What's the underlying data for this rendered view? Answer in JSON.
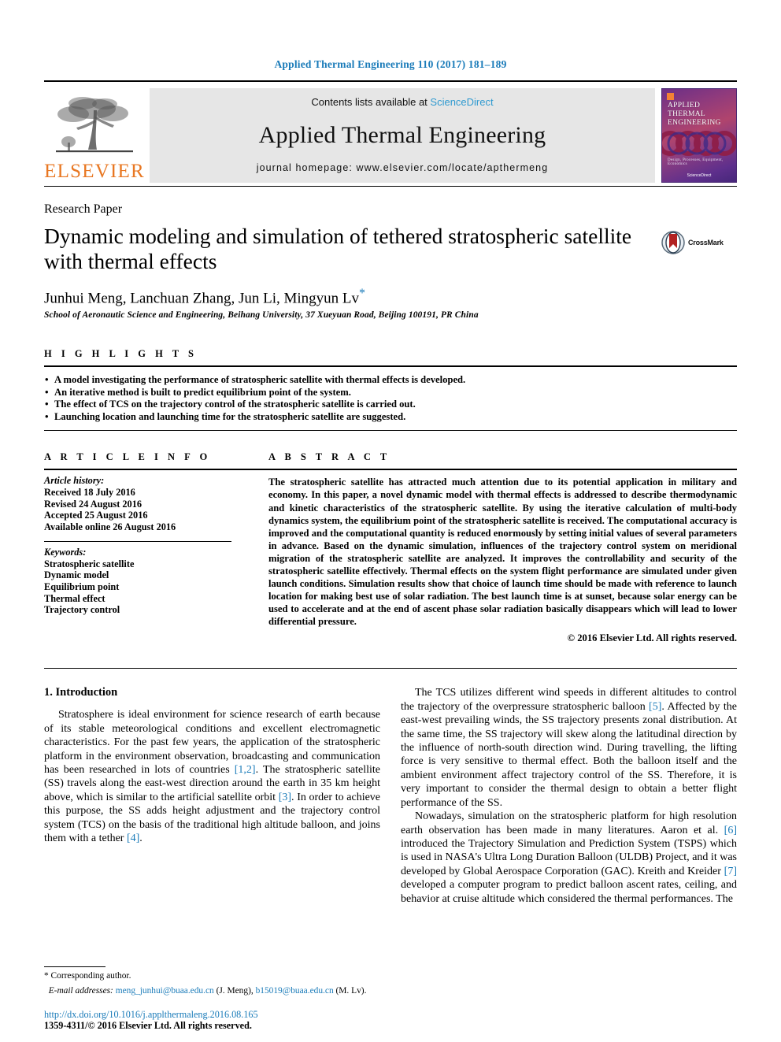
{
  "running_head": "Applied Thermal Engineering 110 (2017) 181–189",
  "masthead": {
    "publisher_name": "ELSEVIER",
    "publisher_logo_icon": "elsevier-tree-icon",
    "contents_prefix": "Contents lists available at ",
    "contents_link": "ScienceDirect",
    "journal_name": "Applied Thermal Engineering",
    "homepage": "journal homepage: www.elsevier.com/locate/apthermeng",
    "cover": {
      "title_line1": "APPLIED",
      "title_line2": "THERMAL",
      "title_line3": "ENGINEERING",
      "footer_line": "Design, Processes, Equipment, Economics",
      "footer_line2": "ScienceDirect"
    }
  },
  "article": {
    "type": "Research Paper",
    "title": "Dynamic modeling and simulation of tethered stratospheric satellite with thermal effects",
    "crossmark_label": "CrossMark",
    "crossmark_icon": "crossmark-icon",
    "authors": "Junhui Meng, Lanchuan Zhang, Jun Li, Mingyun Lv",
    "corresponding_marker": "*",
    "affiliation": "School of Aeronautic Science and Engineering, Beihang University, 37 Xueyuan Road, Beijing 100191, PR China"
  },
  "highlights": {
    "heading": "H I G H L I G H T S",
    "items": [
      "A model investigating the performance of stratospheric satellite with thermal effects is developed.",
      "An iterative method is built to predict equilibrium point of the system.",
      "The effect of TCS on the trajectory control of the stratospheric satellite is carried out.",
      "Launching location and launching time for the stratospheric satellite are suggested."
    ]
  },
  "article_info": {
    "heading": "A R T I C L E    I N F O",
    "history_label": "Article history:",
    "history": [
      "Received 18 July 2016",
      "Revised 24 August 2016",
      "Accepted 25 August 2016",
      "Available online 26 August 2016"
    ],
    "keywords_label": "Keywords:",
    "keywords": [
      "Stratospheric satellite",
      "Dynamic model",
      "Equilibrium point",
      "Thermal effect",
      "Trajectory control"
    ]
  },
  "abstract": {
    "heading": "A B S T R A C T",
    "text": "The stratospheric satellite has attracted much attention due to its potential application in military and economy. In this paper, a novel dynamic model with thermal effects is addressed to describe thermodynamic and kinetic characteristics of the stratospheric satellite. By using the iterative calculation of multi-body dynamics system, the equilibrium point of the stratospheric satellite is received. The computational accuracy is improved and the computational quantity is reduced enormously by setting initial values of several parameters in advance. Based on the dynamic simulation, influences of the trajectory control system on meridional migration of the stratospheric satellite are analyzed. It improves the controllability and security of the stratospheric satellite effectively. Thermal effects on the system flight performance are simulated under given launch conditions. Simulation results show that choice of launch time should be made with reference to launch location for making best use of solar radiation. The best launch time is at sunset, because solar energy can be used to accelerate and at the end of ascent phase solar radiation basically disappears which will lead to lower differential pressure.",
    "copyright": "© 2016 Elsevier Ltd. All rights reserved."
  },
  "body": {
    "section_heading": "1. Introduction",
    "left_paragraphs": [
      "Stratosphere is ideal environment for science research of earth because of its stable meteorological conditions and excellent electromagnetic characteristics. For the past few years, the application of the stratospheric platform in the environment observation, broadcasting and communication has been researched in lots of countries [1,2]. The stratospheric satellite (SS) travels along the east-west direction around the earth in 35 km height above, which is similar to the artificial satellite orbit [3]. In order to achieve this purpose, the SS adds height adjustment and the trajectory control system (TCS) on the basis of the traditional high altitude balloon, and joins them with a tether [4]."
    ],
    "right_paragraphs": [
      "The TCS utilizes different wind speeds in different altitudes to control the trajectory of the overpressure stratospheric balloon [5]. Affected by the east-west prevailing winds, the SS trajectory presents zonal distribution. At the same time, the SS trajectory will skew along the latitudinal direction by the influence of north-south direction wind. During travelling, the lifting force is very sensitive to thermal effect. Both the balloon itself and the ambient environment affect trajectory control of the SS. Therefore, it is very important to consider the thermal design to obtain a better flight performance of the SS.",
      "Nowadays, simulation on the stratospheric platform for high resolution earth observation has been made in many literatures. Aaron et al. [6] introduced the Trajectory Simulation and Prediction System (TSPS) which is used in NASA's Ultra Long Duration Balloon (ULDB) Project, and it was developed by Global Aerospace Corporation (GAC). Kreith and Kreider [7] developed a computer program to predict balloon ascent rates, ceiling, and behavior at cruise altitude which considered the thermal performances. The"
    ]
  },
  "footnote": {
    "corresponding": "* Corresponding author.",
    "email_label": "E-mail addresses:",
    "email1": "meng_junhui@buaa.edu.cn",
    "email1_owner": "(J. Meng),",
    "email2": "b15019@buaa.edu.cn",
    "email2_owner": "(M. Lv)."
  },
  "footer": {
    "doi": "http://dx.doi.org/10.1016/j.applthermaleng.2016.08.165",
    "issn": "1359-4311/© 2016 Elsevier Ltd. All rights reserved."
  },
  "colors": {
    "link_blue": "#1a7bb9",
    "sciencedirect_blue": "#2f9ad0",
    "elsevier_orange": "#E87722",
    "band_gray": "#e6e6e6"
  }
}
